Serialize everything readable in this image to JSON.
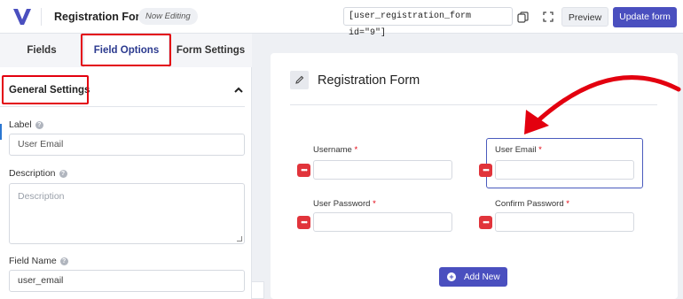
{
  "header": {
    "app_title": "Registration Form",
    "badge": "Now Editing",
    "shortcode": "[user_registration_form id=\"9\"]",
    "preview_label": "Preview",
    "update_label": "Update form"
  },
  "sidebar": {
    "tabs": [
      {
        "label": "Fields"
      },
      {
        "label": "Field Options"
      },
      {
        "label": "Form Settings"
      }
    ],
    "active_tab": "Field Options",
    "section_title": "General Settings",
    "fields": {
      "label": {
        "label": "Label",
        "value": "User Email"
      },
      "description": {
        "label": "Description",
        "placeholder": "Description"
      },
      "field_name": {
        "label": "Field Name",
        "value": "user_email"
      }
    }
  },
  "form": {
    "title": "Registration Form",
    "rows": [
      {
        "left": {
          "label": "Username",
          "required": "*"
        },
        "right": {
          "label": "User Email",
          "required": "*"
        }
      },
      {
        "left": {
          "label": "User Password",
          "required": "*"
        },
        "right": {
          "label": "Confirm Password",
          "required": "*"
        }
      }
    ],
    "add_new_label": "Add New"
  },
  "annotations": {
    "highlight_color": "#e3000f",
    "accent_color": "#4a4fbf"
  },
  "icons": [
    "logo-icon",
    "copy-icon",
    "fullscreen-icon",
    "chevron-up-icon",
    "help-icon",
    "pencil-icon",
    "drag-handle-icon",
    "plus-icon"
  ]
}
